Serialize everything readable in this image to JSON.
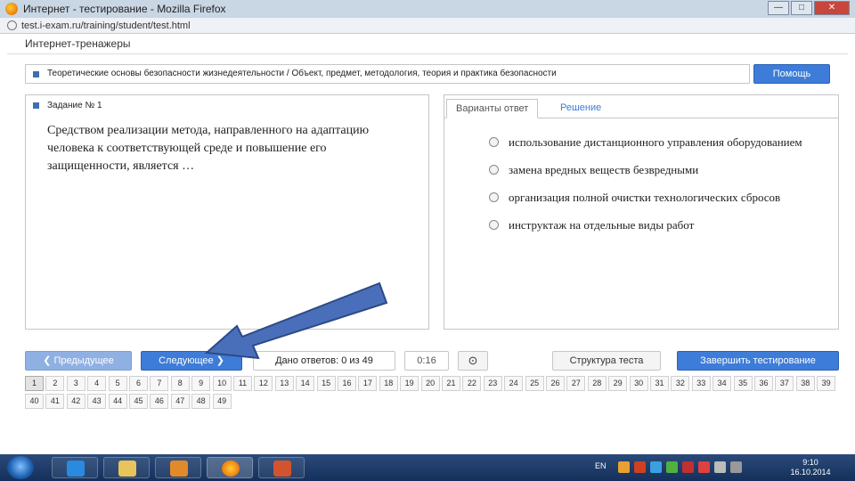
{
  "window": {
    "title": "Интернет - тестирование - Mozilla Firefox",
    "controls": [
      "—",
      "□",
      "✕"
    ],
    "address": "test.i-exam.ru/training/student/test.html"
  },
  "page": {
    "brand": "Интернет-тренажеры",
    "topic": "Теоретические основы безопасности жизнедеятельности / Объект, предмет, методология, теория и практика безопасности",
    "help_label": "Помощь"
  },
  "question": {
    "label": "Задание № 1",
    "text": "Средством реализации метода, направленного на адаптацию человека к соответствующей среде и повышение его защищенности, является …"
  },
  "answers": {
    "tabs": [
      "Варианты ответ",
      "Решение"
    ],
    "options": [
      "использование дистанционного управления оборудованием",
      "замена вредных веществ безвредными",
      "организация полной очистки технологических сбросов",
      "инструктаж на отдельные виды работ"
    ]
  },
  "nav": {
    "prev_label": "❮ Предыдущее",
    "next_label": "Следующее ❯",
    "counter": "Дано ответов: 0 из 49",
    "timer": "0:16",
    "timer_icon": "⊙",
    "structure_label": "Структура теста",
    "finish_label": "Завершить тестирование"
  },
  "pager": {
    "current": 1,
    "pages": [
      "1",
      "2",
      "3",
      "4",
      "5",
      "6",
      "7",
      "8",
      "9",
      "10",
      "11",
      "12",
      "13",
      "14",
      "15",
      "16",
      "17",
      "18",
      "19",
      "20",
      "21",
      "22",
      "23",
      "24",
      "25",
      "26",
      "27",
      "28",
      "29",
      "30",
      "31",
      "32",
      "33",
      "34",
      "35",
      "36",
      "37",
      "38",
      "39",
      "40",
      "41",
      "42",
      "43",
      "44",
      "45",
      "46",
      "47",
      "48",
      "49"
    ]
  },
  "taskbar": {
    "lang": "EN",
    "time": "9:10",
    "date": "16.10.2014"
  },
  "colors": {
    "accent": "#3d7cd8",
    "arrow": "#4a6fba",
    "taskbar": "#1e3d6b"
  }
}
